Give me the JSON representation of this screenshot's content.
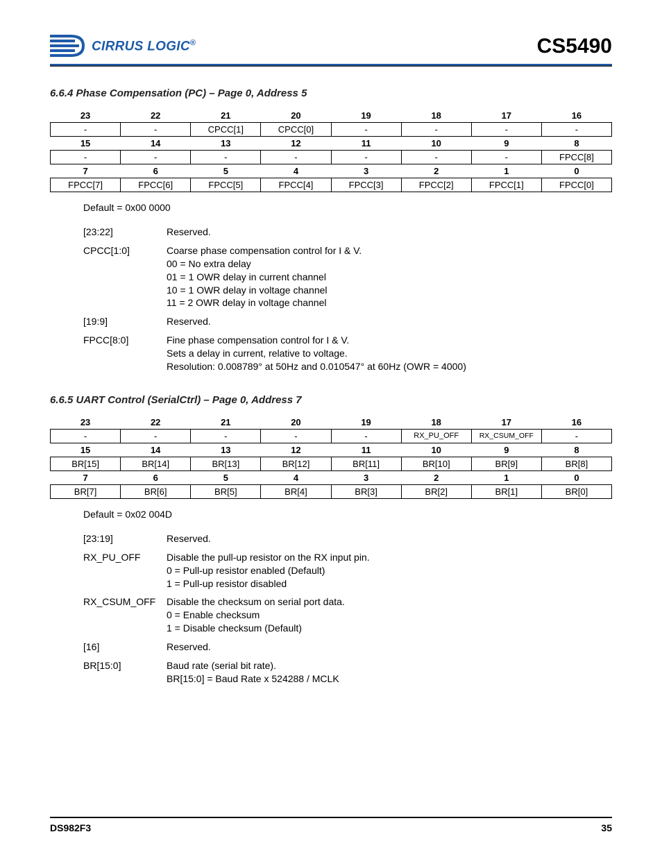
{
  "header": {
    "brand_text": "CIRRUS LOGIC",
    "brand_suffix": "®",
    "part_number": "CS5490"
  },
  "section1": {
    "heading": "6.6.4  Phase Compensation (PC) – Page 0, Address 5",
    "bit_table": {
      "row1_hdr": [
        "23",
        "22",
        "21",
        "20",
        "19",
        "18",
        "17",
        "16"
      ],
      "row1_val": [
        "-",
        "-",
        "CPCC[1]",
        "CPCC[0]",
        "-",
        "-",
        "-",
        "-"
      ],
      "row2_hdr": [
        "15",
        "14",
        "13",
        "12",
        "11",
        "10",
        "9",
        "8"
      ],
      "row2_val": [
        "-",
        "-",
        "-",
        "-",
        "-",
        "-",
        "-",
        "FPCC[8]"
      ],
      "row3_hdr": [
        "7",
        "6",
        "5",
        "4",
        "3",
        "2",
        "1",
        "0"
      ],
      "row3_val": [
        "FPCC[7]",
        "FPCC[6]",
        "FPCC[5]",
        "FPCC[4]",
        "FPCC[3]",
        "FPCC[2]",
        "FPCC[1]",
        "FPCC[0]"
      ]
    },
    "default": "Default = 0x00 0000",
    "desc": [
      {
        "k": "[23:22]",
        "v": "Reserved."
      },
      {
        "k": "CPCC[1:0]",
        "v": "Coarse phase compensation control for I & V.\n00 = No extra delay\n01 = 1 OWR delay in current channel\n10 = 1 OWR delay in voltage channel\n11 = 2 OWR delay in voltage channel"
      },
      {
        "k": "[19:9]",
        "v": "Reserved."
      },
      {
        "k": "FPCC[8:0]",
        "v": "Fine phase compensation control for I & V.\nSets a delay in current, relative to voltage.\nResolution: 0.008789° at 50Hz and 0.010547° at 60Hz (OWR = 4000)"
      }
    ]
  },
  "section2": {
    "heading": "6.6.5  UART Control (SerialCtrl) – Page 0, Address 7",
    "bit_table": {
      "row1_hdr": [
        "23",
        "22",
        "21",
        "20",
        "19",
        "18",
        "17",
        "16"
      ],
      "row1_val": [
        "-",
        "-",
        "-",
        "-",
        "-",
        "RX_PU_OFF",
        "RX_CSUM_OFF",
        "-"
      ],
      "row2_hdr": [
        "15",
        "14",
        "13",
        "12",
        "11",
        "10",
        "9",
        "8"
      ],
      "row2_val": [
        "BR[15]",
        "BR[14]",
        "BR[13]",
        "BR[12]",
        "BR[11]",
        "BR[10]",
        "BR[9]",
        "BR[8]"
      ],
      "row3_hdr": [
        "7",
        "6",
        "5",
        "4",
        "3",
        "2",
        "1",
        "0"
      ],
      "row3_val": [
        "BR[7]",
        "BR[6]",
        "BR[5]",
        "BR[4]",
        "BR[3]",
        "BR[2]",
        "BR[1]",
        "BR[0]"
      ]
    },
    "default": "Default = 0x02 004D",
    "desc": [
      {
        "k": "[23:19]",
        "v": "Reserved."
      },
      {
        "k": "RX_PU_OFF",
        "v": "Disable the pull-up resistor on the RX input pin.\n0 = Pull-up resistor enabled (Default)\n1 = Pull-up resistor disabled"
      },
      {
        "k": "RX_CSUM_OFF",
        "v": "Disable the checksum on serial port data.\n0 = Enable checksum\n1 = Disable checksum (Default)"
      },
      {
        "k": "[16]",
        "v": "Reserved."
      },
      {
        "k": "BR[15:0]",
        "v": "Baud rate (serial bit rate).\nBR[15:0] = Baud Rate x 524288 / MCLK"
      }
    ]
  },
  "footer": {
    "doc_id": "DS982F3",
    "page_num": "35"
  }
}
